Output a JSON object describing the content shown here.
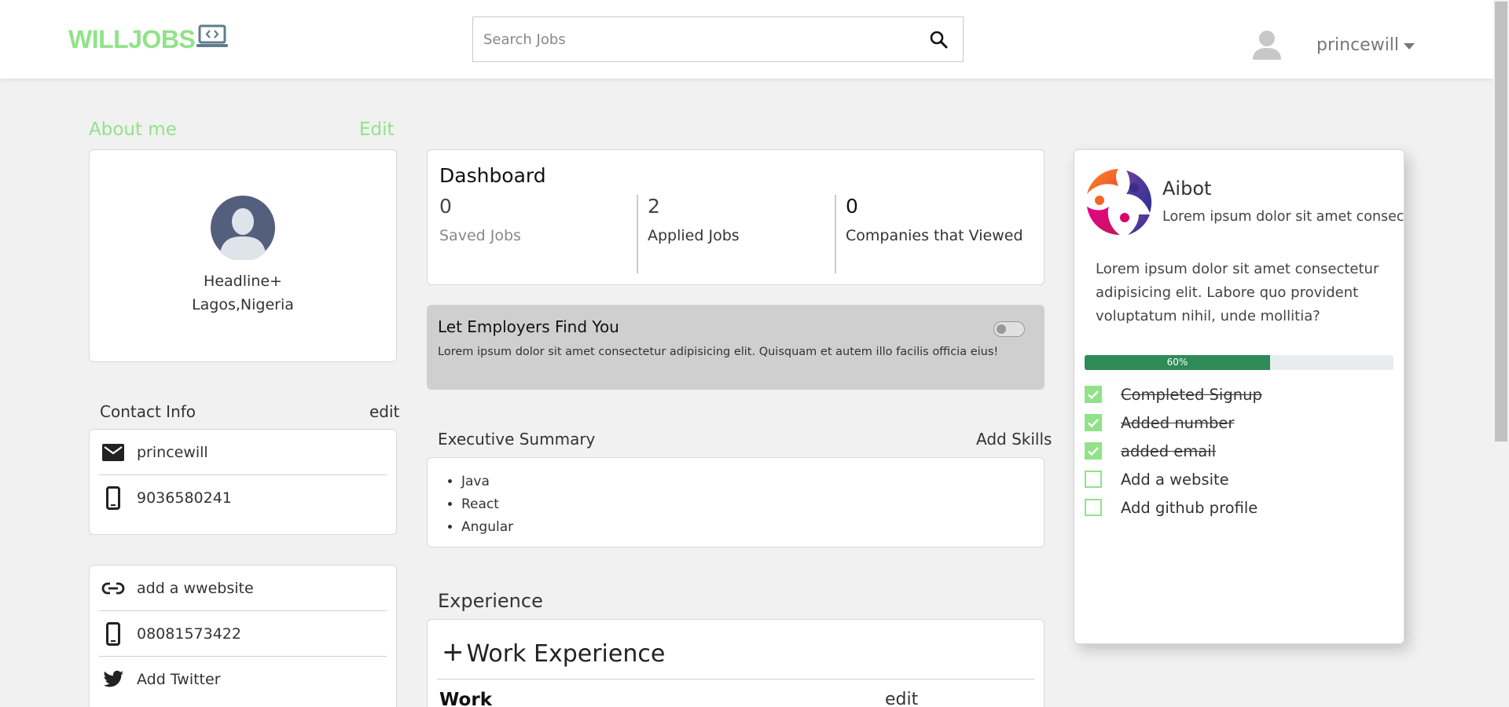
{
  "header": {
    "logo_text": "WILLJOBS",
    "search_placeholder": "Search Jobs",
    "username": "princewill"
  },
  "about": {
    "title": "About me",
    "edit_label": "Edit",
    "headline": "Headline+",
    "location": "Lagos,Nigeria"
  },
  "contact": {
    "title": "Contact Info",
    "edit_label": "edit",
    "email": "princewill",
    "phone": "9036580241"
  },
  "links": {
    "website": "add a wwebsite",
    "phone": "08081573422",
    "twitter": "Add Twitter"
  },
  "dashboard": {
    "title": "Dashboard",
    "stats": [
      {
        "value": "0",
        "label": "Saved Jobs",
        "color": "#888888"
      },
      {
        "value": "2",
        "label": "Applied Jobs",
        "color": "#333333"
      },
      {
        "value": "0",
        "label": "Companies that Viewed",
        "color": "#333333"
      }
    ]
  },
  "employer": {
    "title": "Let Employers Find You",
    "description": "Lorem ipsum dolor sit amet consectetur adipisicing elit. Quisquam et autem illo facilis officia eius!",
    "toggle_on": false
  },
  "executive_summary": {
    "title": "Executive Summary",
    "add_label": "Add Skills",
    "skills": [
      "Java",
      "React",
      "Angular"
    ]
  },
  "experience": {
    "title": "Experience",
    "add_label": "Work Experience",
    "work_label": "Work",
    "edit_label": "edit"
  },
  "aibot": {
    "name": "Aibot",
    "subtitle": "Lorem ipsum dolor sit amet consec",
    "description": "Lorem ipsum dolor sit amet consectetur adipisicing elit. Labore quo provident voluptatum nihil, unde mollitia?",
    "progress_percent": 60,
    "progress_label": "60%",
    "checklist": [
      {
        "label": "Completed Signup",
        "done": true
      },
      {
        "label": "Added number",
        "done": true
      },
      {
        "label": "added email",
        "done": true
      },
      {
        "label": "Add a website",
        "done": false
      },
      {
        "label": "Add github profile",
        "done": false
      }
    ]
  },
  "colors": {
    "accent": "#90e388",
    "progress": "#2e8b57",
    "background": "#f1f1f1"
  }
}
